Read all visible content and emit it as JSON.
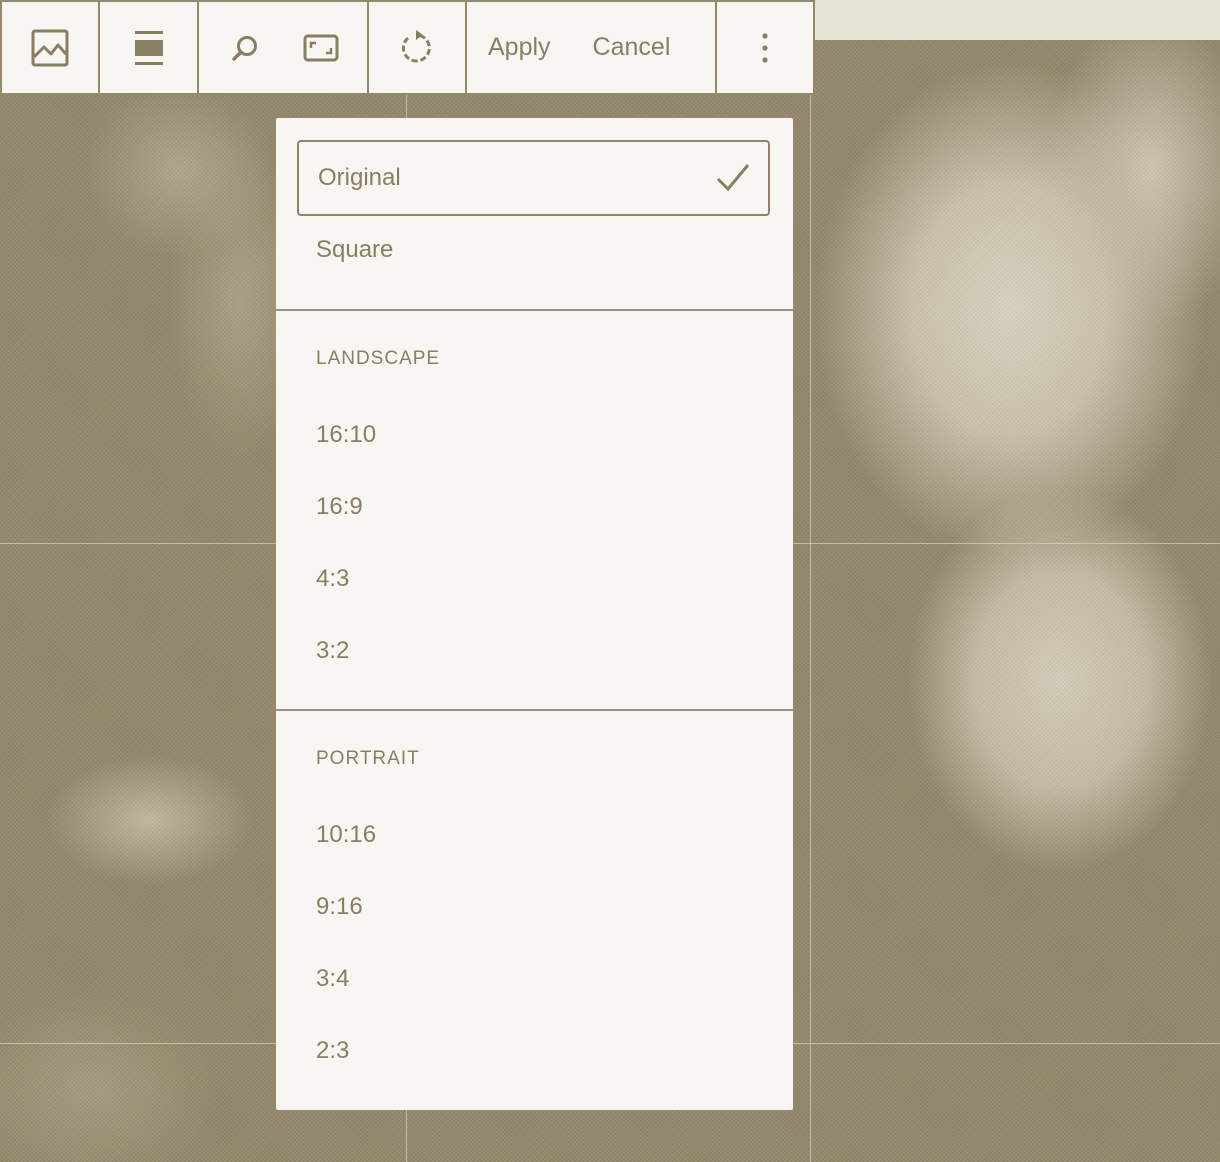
{
  "toolbar": {
    "image_icon": "image-icon",
    "align_icon": "align-full-width-icon",
    "search_icon": "search-icon",
    "aspect_ratio_icon": "aspect-ratio-icon",
    "rotate_icon": "rotate-icon",
    "apply_label": "Apply",
    "cancel_label": "Cancel",
    "more_icon": "more-vertical-icon"
  },
  "aspect_menu": {
    "selected": "Original",
    "top_items": [
      {
        "label": "Original",
        "selected": true
      },
      {
        "label": "Square",
        "selected": false
      }
    ],
    "landscape": {
      "heading": "LANDSCAPE",
      "items": [
        "16:10",
        "16:9",
        "4:3",
        "3:2"
      ]
    },
    "portrait": {
      "heading": "PORTRAIT",
      "items": [
        "10:16",
        "9:16",
        "3:4",
        "2:3"
      ]
    }
  },
  "colors": {
    "background_tone": "#93886b",
    "surface": "#f7f6f2",
    "text": "#8a7e60"
  }
}
